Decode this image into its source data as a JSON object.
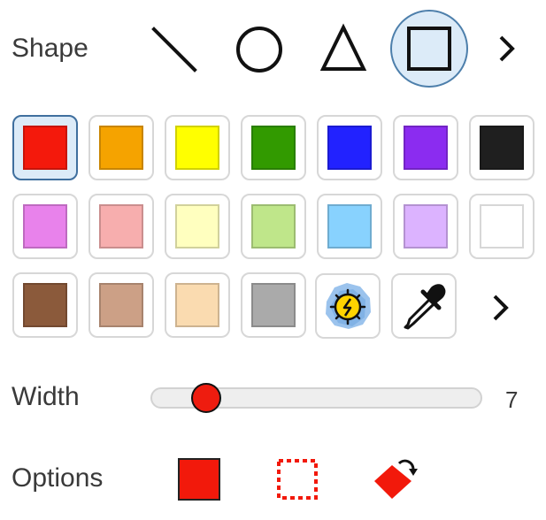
{
  "shape_row": {
    "label": "Shape",
    "tools": [
      {
        "name": "line",
        "icon": "line-icon",
        "selected": false
      },
      {
        "name": "circle",
        "icon": "circle-icon",
        "selected": false
      },
      {
        "name": "triangle",
        "icon": "triangle-icon",
        "selected": false
      },
      {
        "name": "square",
        "icon": "square-icon",
        "selected": true
      }
    ],
    "more_icon": "chevron-right-icon"
  },
  "palette": {
    "selected_color": "#f4190c",
    "colors": [
      [
        "#f4190c",
        "#f5a300",
        "#ffff00",
        "#329a00",
        "#2222ff",
        "#8b2cf0",
        "#1f1f1f"
      ],
      [
        "#e882eb",
        "#f7aeae",
        "#ffffbf",
        "#bfe68a",
        "#88d2fe",
        "#dcb3ff",
        "#ffffff"
      ],
      [
        "#8b5a3b",
        "#cca086",
        "#fadbb0",
        "#aaaaaa"
      ]
    ],
    "extra_tools": [
      "random-color-icon",
      "eyedropper-icon"
    ],
    "more_icon": "chevron-right-icon"
  },
  "width_row": {
    "label": "Width",
    "value": "7",
    "level": 0.16,
    "thumb_color": "#ee1c0f"
  },
  "options_row": {
    "label": "Options",
    "items": [
      "fill-icon",
      "dashed-outline-icon",
      "rotate-icon"
    ],
    "accent": "#f2190b"
  }
}
